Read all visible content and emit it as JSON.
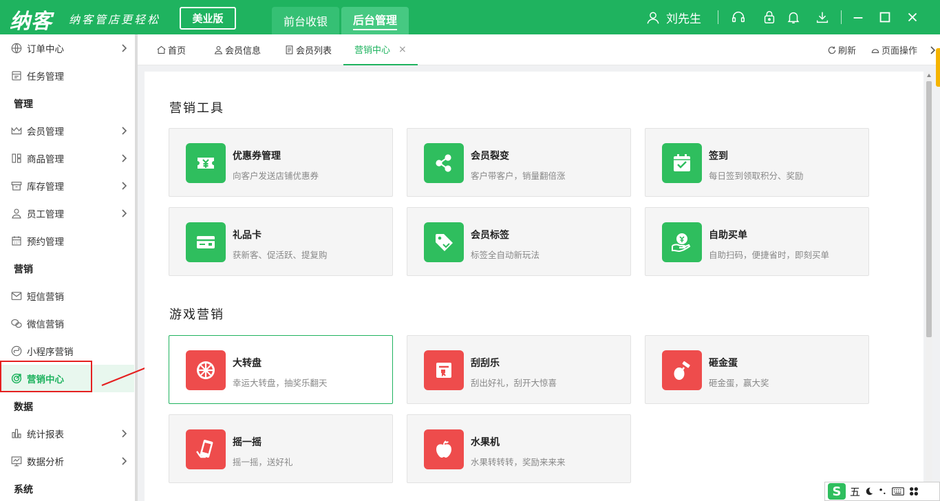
{
  "app": {
    "logo": "纳客",
    "slogan": "纳客管店更轻松",
    "edition": "美业版",
    "top_tabs": [
      "前台收银",
      "后台管理"
    ],
    "user_name": "刘先生"
  },
  "sidebar": {
    "items": [
      {
        "label": "订单中心",
        "icon": "globe-icon",
        "arrow": true
      },
      {
        "label": "任务管理",
        "icon": "task-icon",
        "arrow": false
      }
    ],
    "sections": [
      {
        "title": "管理",
        "items": [
          {
            "label": "会员管理",
            "icon": "crown-icon",
            "arrow": true
          },
          {
            "label": "商品管理",
            "icon": "goods-icon",
            "arrow": true
          },
          {
            "label": "库存管理",
            "icon": "inventory-icon",
            "arrow": true
          },
          {
            "label": "员工管理",
            "icon": "staff-icon",
            "arrow": true
          },
          {
            "label": "预约管理",
            "icon": "calendar-icon",
            "arrow": false
          }
        ]
      },
      {
        "title": "营销",
        "items": [
          {
            "label": "短信营销",
            "icon": "mail-icon",
            "arrow": false
          },
          {
            "label": "微信营销",
            "icon": "wechat-icon",
            "arrow": false
          },
          {
            "label": "小程序营销",
            "icon": "miniprogram-icon",
            "arrow": false
          },
          {
            "label": "营销中心",
            "icon": "target-icon",
            "arrow": false,
            "active": true
          }
        ]
      },
      {
        "title": "数据",
        "items": [
          {
            "label": "统计报表",
            "icon": "bar-chart-icon",
            "arrow": true
          },
          {
            "label": "数据分析",
            "icon": "analysis-icon",
            "arrow": true
          }
        ]
      },
      {
        "title": "系统",
        "items": []
      }
    ]
  },
  "tabs": {
    "items": [
      "首页",
      "会员信息",
      "会员列表",
      "营销中心"
    ],
    "active": "营销中心",
    "close_glyph": "×",
    "refresh": "刷新",
    "page_ops": "页面操作"
  },
  "marketing_tools": {
    "title": "营销工具",
    "cards": [
      {
        "title": "优惠券管理",
        "desc": "向客户发送店铺优惠券",
        "icon": "coupon-icon"
      },
      {
        "title": "会员裂变",
        "desc": "客户带客户，销量翻倍涨",
        "icon": "share-icon"
      },
      {
        "title": "签到",
        "desc": "每日签到领取积分、奖励",
        "icon": "checkin-icon"
      },
      {
        "title": "礼品卡",
        "desc": "获新客、促活跃、提复购",
        "icon": "gift-card-icon"
      },
      {
        "title": "会员标签",
        "desc": "标签全自动新玩法",
        "icon": "tag-icon"
      },
      {
        "title": "自助买单",
        "desc": "自助扫码，便捷省时，即刻买单",
        "icon": "self-pay-icon"
      }
    ]
  },
  "game_marketing": {
    "title": "游戏营销",
    "cards": [
      {
        "title": "大转盘",
        "desc": "幸运大转盘，抽奖乐翻天",
        "icon": "wheel-icon",
        "selected": true
      },
      {
        "title": "刮刮乐",
        "desc": "刮出好礼，刮开大惊喜",
        "icon": "scratch-icon"
      },
      {
        "title": "砸金蛋",
        "desc": "砸金蛋，赢大奖",
        "icon": "golden-egg-icon"
      },
      {
        "title": "摇一摇",
        "desc": "摇一摇，送好礼",
        "icon": "shake-icon"
      },
      {
        "title": "水果机",
        "desc": "水果转转转，奖励来来来",
        "icon": "fruit-machine-icon"
      }
    ]
  },
  "ime": {
    "mode": "五",
    "logo": "S"
  },
  "colors": {
    "brand": "#1fb35f",
    "tool_icon_bg": "#2fbe5e",
    "game_icon_bg": "#ee4c4c",
    "annotation": "#e52020"
  }
}
